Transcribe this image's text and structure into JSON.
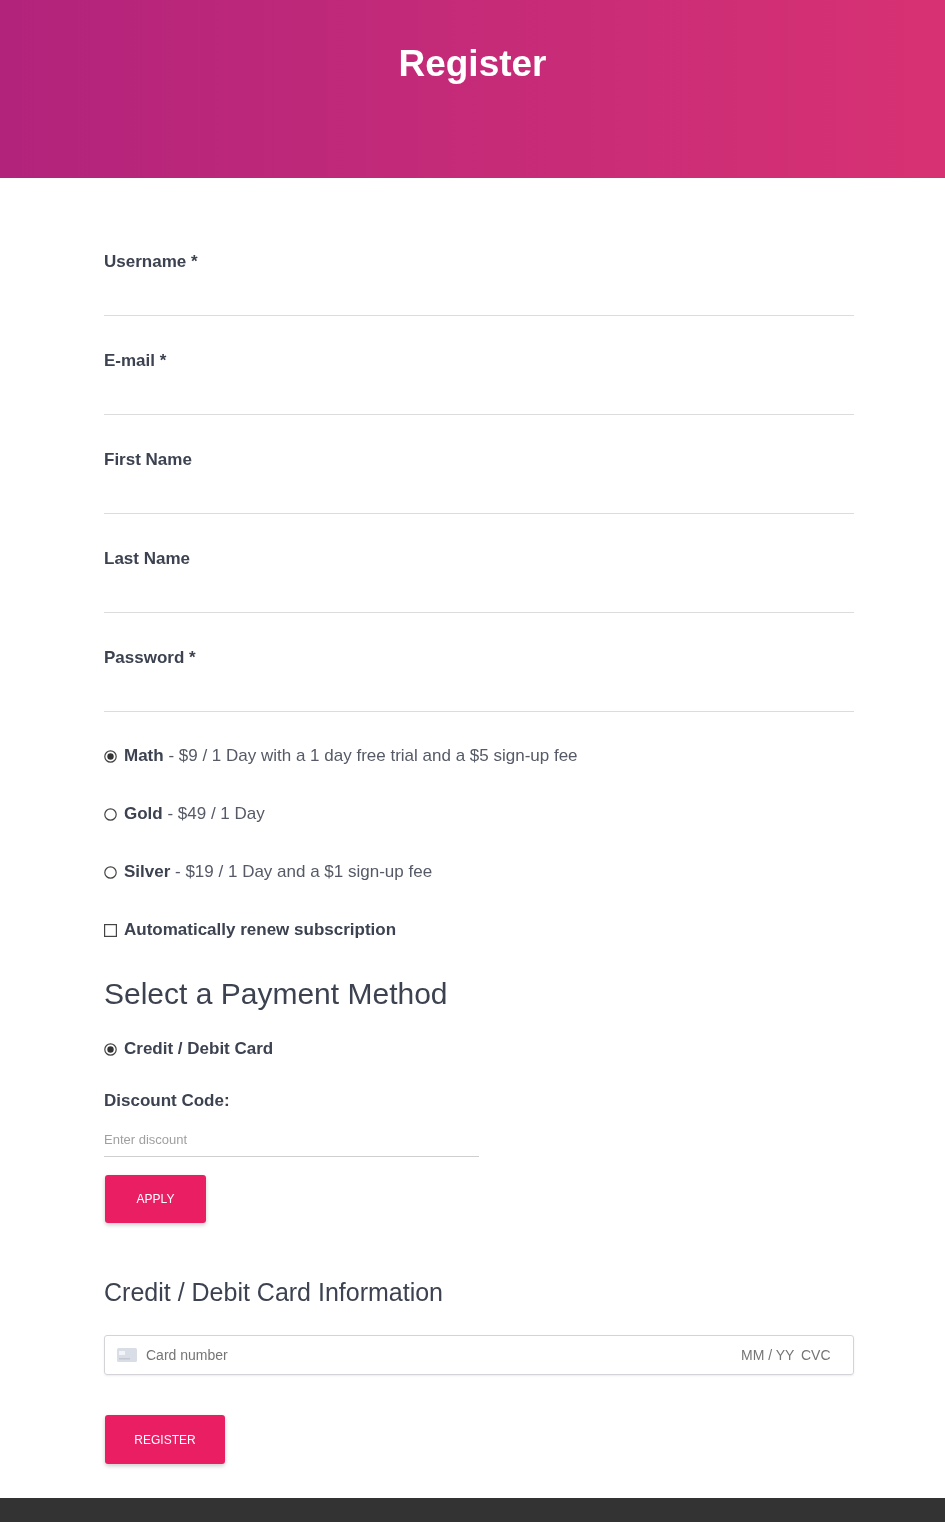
{
  "header": {
    "title": "Register"
  },
  "fields": [
    {
      "label": "Username *"
    },
    {
      "label": "E-mail *"
    },
    {
      "label": "First Name"
    },
    {
      "label": "Last Name"
    },
    {
      "label": "Password *"
    }
  ],
  "plans": [
    {
      "text": "**Math** - $9 / 1 Day with a 1 day free trial and a $5 sign-up fee",
      "selected": true
    },
    {
      "text": "**Gold** - $49 / 1 Day",
      "selected": false
    },
    {
      "text": "**Silver** - $19 / 1 Day and a $1 sign-up fee",
      "selected": false
    }
  ],
  "auto_renew": {
    "label": "Automatically renew subscription",
    "checked": false
  },
  "payment": {
    "heading": "Select a Payment Method",
    "methods": [
      {
        "label": "Credit / Debit Card",
        "selected": true
      }
    ]
  },
  "discount": {
    "label": "Discount Code:",
    "placeholder": "Enter discount",
    "button": "APPLY"
  },
  "card": {
    "heading": "Credit / Debit Card Information",
    "number_placeholder": "Card number",
    "expiry_placeholder": "MM / YY",
    "cvc_placeholder": "CVC"
  },
  "submit": {
    "label": "REGISTER"
  }
}
